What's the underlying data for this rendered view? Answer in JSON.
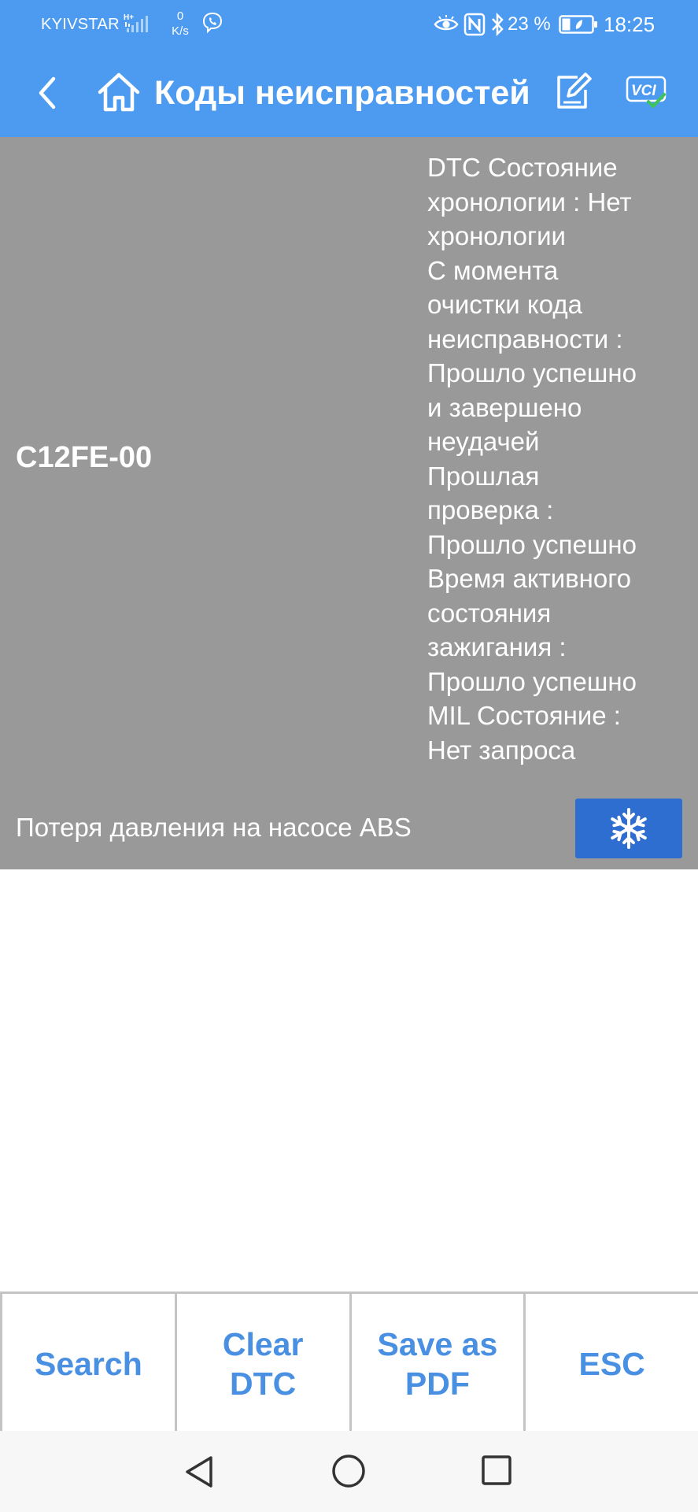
{
  "status_bar": {
    "carrier": "KYIVSTAR",
    "network_type": "H+",
    "speed_value": "0",
    "speed_unit": "K/s",
    "battery_percent": "23 %",
    "time": "18:25",
    "icons": [
      "signal-icon",
      "viber-icon",
      "eye-icon",
      "nfc-icon",
      "bluetooth-icon",
      "battery-icon"
    ]
  },
  "app_bar": {
    "title": "Коды неисправностей",
    "icons": [
      "back-icon",
      "home-icon",
      "edit-icon",
      "vci-icon"
    ],
    "vci_label": "VCI",
    "background_color": "#4d9bf0"
  },
  "dtc": {
    "code": "C12FE-00",
    "details": [
      "DTC Состояние",
      "хронологии : Нет",
      "хронологии",
      "С момента",
      "очистки кода",
      "неисправности :",
      "Прошло успешно",
      "и завершено",
      "неудачей",
      "Прошлая",
      "проверка :",
      "Прошло успешно",
      "Время активного",
      "состояния",
      "зажигания :",
      "Прошло успешно",
      "MIL Состояние :",
      "Нет запроса"
    ],
    "description": "Потеря давления на насосе ABS",
    "freeze_frame_icon": "snowflake-icon",
    "panel_color": "#999999",
    "button_color": "#2f6ed1"
  },
  "toolbar": {
    "buttons": [
      {
        "label": "Search"
      },
      {
        "label": "Clear\nDTC"
      },
      {
        "label": "Save as\nPDF"
      },
      {
        "label": "ESC"
      }
    ],
    "text_color": "#4a90e2"
  },
  "nav_bar": {
    "icons": [
      "nav-back-icon",
      "nav-home-icon",
      "nav-recent-icon"
    ]
  }
}
